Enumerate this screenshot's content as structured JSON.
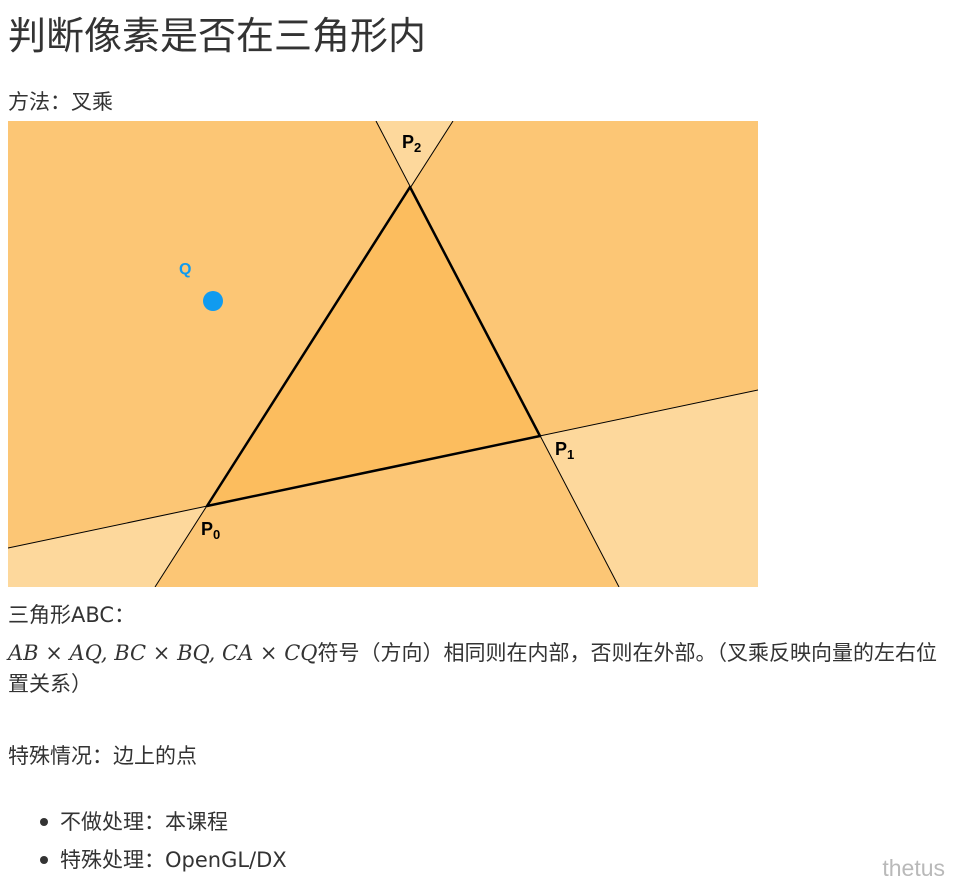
{
  "title": "判断像素是否在三角形内",
  "method": "方法：叉乘",
  "figure": {
    "point_labels": {
      "p0": "P",
      "p0_sub": "0",
      "p1": "P",
      "p1_sub": "1",
      "p2": "P",
      "p2_sub": "2",
      "q": "Q"
    },
    "colors": {
      "outside_one": "#fcc675",
      "outside_two": "#fdd89c",
      "inside": "#fcbd5e",
      "point_q": "#109bf0",
      "edge": "#000000"
    }
  },
  "triangle_label": "三角形ABC：",
  "formula": {
    "math": "AB × AQ, BC × BQ, CA × CQ",
    "text": "符号（方向）相同则在内部，否则在外部。（叉乘反映向量的左右位置关系）"
  },
  "special_case": "特殊情况：边上的点",
  "list": [
    "不做处理：本课程",
    "特殊处理：OpenGL/DX"
  ],
  "watermark": "thetus"
}
